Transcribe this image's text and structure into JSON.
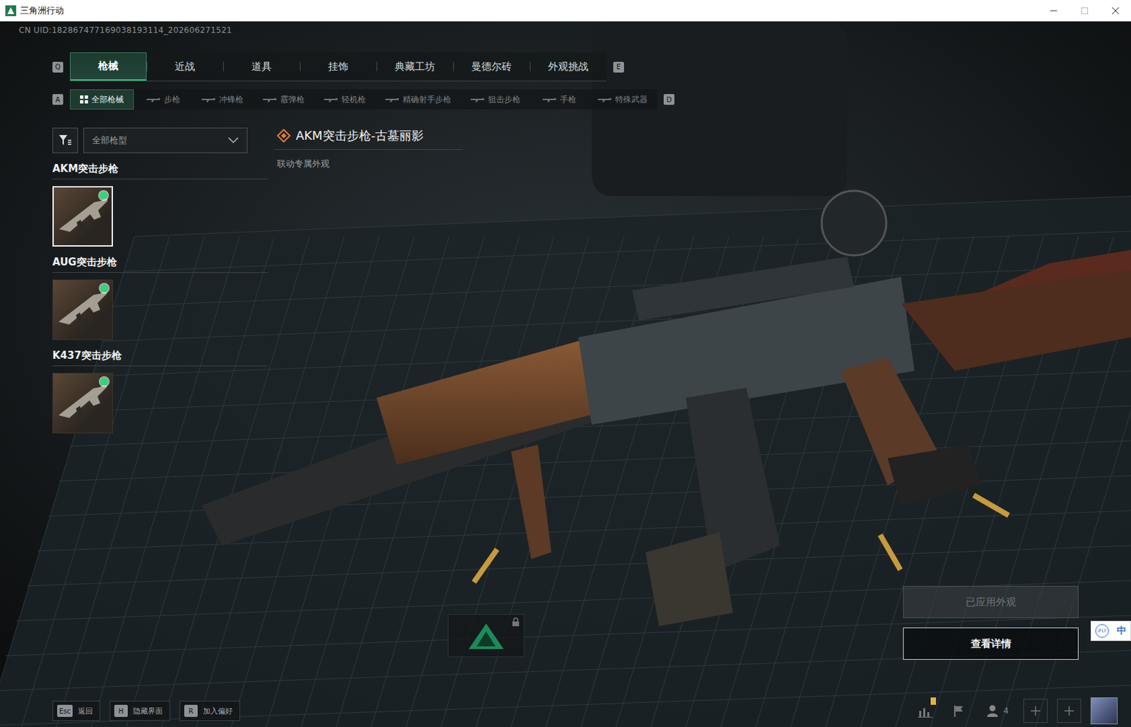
{
  "window": {
    "title": "三角洲行动"
  },
  "uid": "CN UID:182867477169038193114_202606271521",
  "tabs": {
    "prev_key": "Q",
    "next_key": "E",
    "items": [
      {
        "label": "枪械",
        "selected": true
      },
      {
        "label": "近战",
        "selected": false
      },
      {
        "label": "道具",
        "selected": false
      },
      {
        "label": "挂饰",
        "selected": false
      },
      {
        "label": "典藏工坊",
        "selected": false
      },
      {
        "label": "曼德尔砖",
        "selected": false
      },
      {
        "label": "外观挑战",
        "selected": false
      }
    ]
  },
  "subtabs": {
    "prev_key": "A",
    "next_key": "D",
    "items": [
      {
        "label": "全部枪械",
        "selected": true
      },
      {
        "label": "步枪",
        "selected": false
      },
      {
        "label": "冲锋枪",
        "selected": false
      },
      {
        "label": "霰弹枪",
        "selected": false
      },
      {
        "label": "轻机枪",
        "selected": false
      },
      {
        "label": "精确射手步枪",
        "selected": false
      },
      {
        "label": "狙击步枪",
        "selected": false
      },
      {
        "label": "手枪",
        "selected": false
      },
      {
        "label": "特殊武器",
        "selected": false
      }
    ]
  },
  "filter": {
    "value": "全部枪型"
  },
  "groups": [
    {
      "name": "AKM突击步枪",
      "skins": [
        {
          "selected": true,
          "equipped": true
        }
      ]
    },
    {
      "name": "AUG突击步枪",
      "skins": [
        {
          "selected": false,
          "equipped": true
        }
      ]
    },
    {
      "name": "K437突击步枪",
      "skins": [
        {
          "selected": false,
          "equipped": true
        }
      ]
    }
  ],
  "item": {
    "title": "AKM突击步枪-古墓丽影",
    "subtitle": "联动专属外观"
  },
  "buttons": [
    {
      "label": "已应用外观",
      "disabled": true
    },
    {
      "label": "查看详情",
      "disabled": false
    }
  ],
  "hints": [
    {
      "key": "Esc",
      "label": "返回"
    },
    {
      "key": "H",
      "label": "隐藏界面"
    },
    {
      "key": "R",
      "label": "加入偏好"
    }
  ],
  "squad": {
    "count": "4"
  },
  "ime": {
    "brand": "iFLY",
    "mode": "中"
  }
}
